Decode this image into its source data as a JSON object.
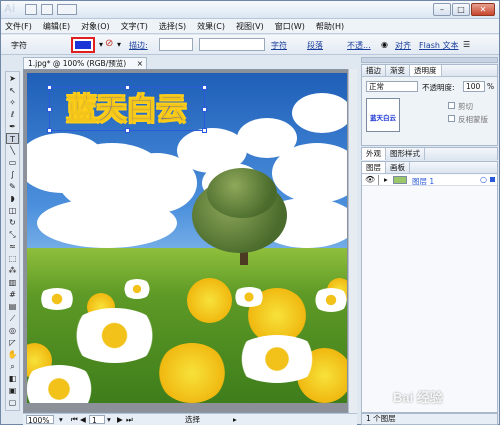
{
  "app": {
    "logo_text": "Ai"
  },
  "window_controls": {
    "minimize": "–",
    "maximize": "□",
    "close": "✕"
  },
  "menu": [
    "文件(F)",
    "编辑(E)",
    "对象(O)",
    "文字(T)",
    "选择(S)",
    "效果(C)",
    "视图(V)",
    "窗口(W)",
    "帮助(H)"
  ],
  "control_bar": {
    "object_type": "字符",
    "fill_color": "#1a34d6",
    "stroke_label": "描边:",
    "char_link": "字符",
    "para_link": "段落",
    "opacity_link": "不透...",
    "align_link": "对齐",
    "flash_link": "Flash 文本"
  },
  "document": {
    "tab_title": "1.jpg* @ 100% (RGB/预览)",
    "close_glyph": "×",
    "art_text": "蓝天白云"
  },
  "status_bar": {
    "zoom": "100%",
    "artboard": "1",
    "mode": "选择"
  },
  "transparency_panel": {
    "tabs": [
      "描边",
      "渐变",
      "透明度"
    ],
    "active_tab": "透明度",
    "blend_mode": "正常",
    "opacity_label": "不透明度:",
    "opacity_value": "100",
    "opacity_unit": "%",
    "thumb_text": "蓝天白云",
    "clip_label": "剪切",
    "invert_label": "反相蒙版"
  },
  "appearance_panel": {
    "tabs": [
      "外观",
      "图形样式"
    ]
  },
  "layers_panel": {
    "tabs": [
      "图层",
      "画板"
    ],
    "layer_name": "图层 1",
    "footer": "1 个图层"
  },
  "watermark": "Bai 经验"
}
